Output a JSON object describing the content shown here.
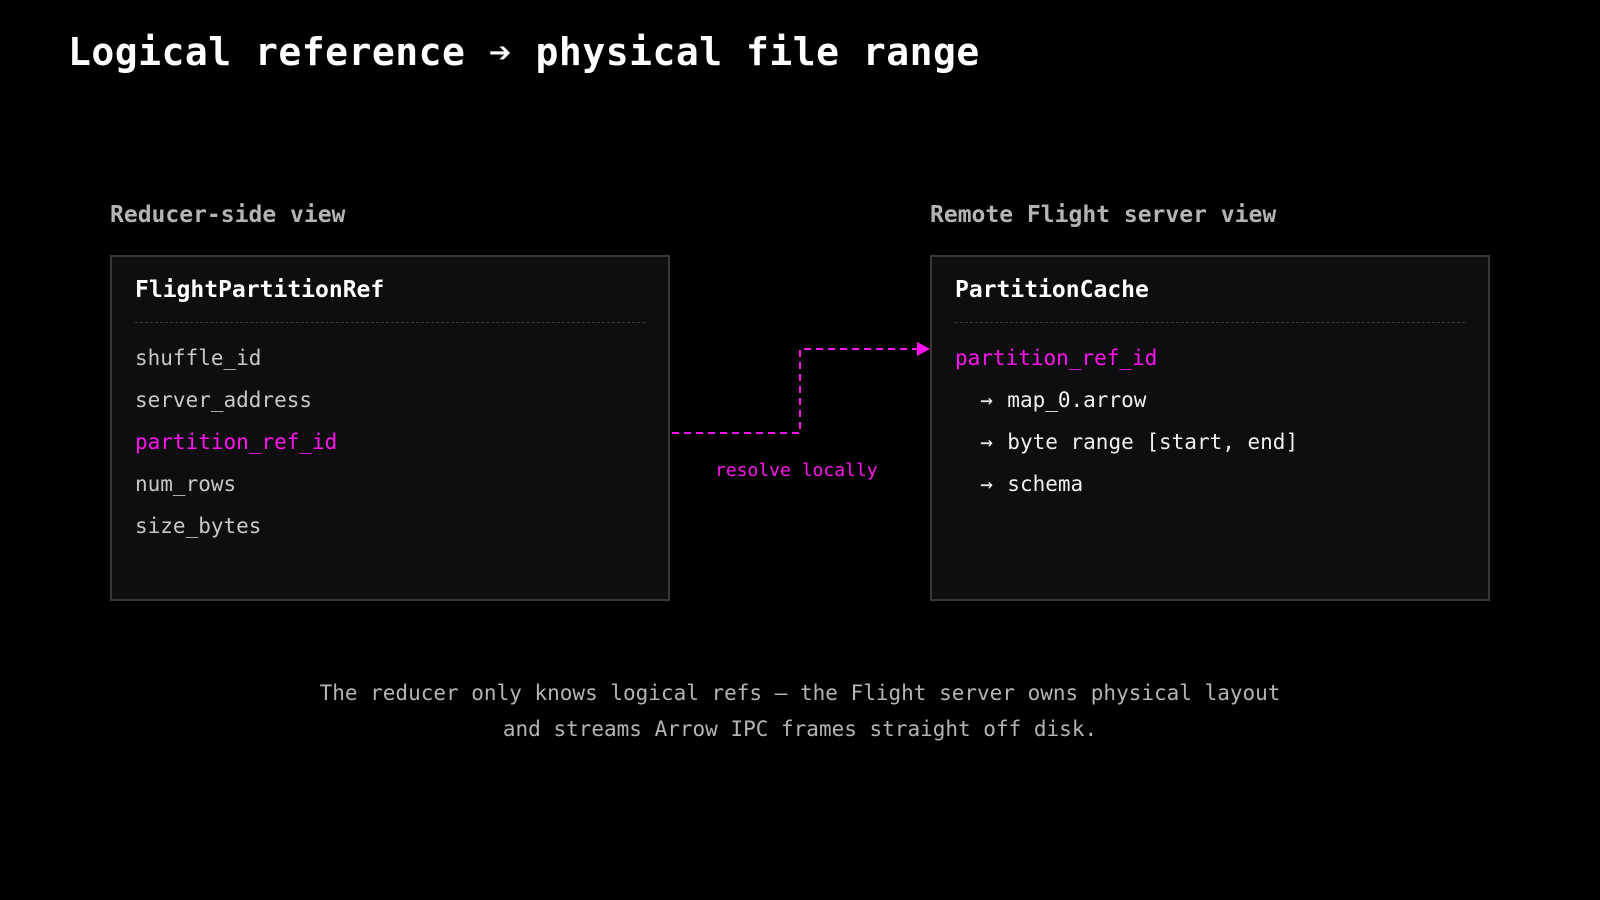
{
  "title": "Logical reference ➔ physical file range",
  "colors": {
    "background": "#000000",
    "panel_background": "#0e0e10",
    "panel_border": "#38383b",
    "accent": "#ff14f0",
    "heading_gray": "#b4b4b4"
  },
  "left_panel": {
    "heading": "Reducer-side view",
    "box_title": "FlightPartitionRef",
    "fields": [
      "shuffle_id",
      "server_address",
      "partition_ref_id",
      "num_rows",
      "size_bytes"
    ],
    "highlighted_field": "partition_ref_id"
  },
  "right_panel": {
    "heading": "Remote Flight server view",
    "box_title": "PartitionCache",
    "key": "partition_ref_id",
    "arrow_symbol": "→",
    "mappings": [
      "map_0.arrow",
      "byte range [start, end]",
      "schema"
    ]
  },
  "connector": {
    "label": "resolve locally",
    "style": "dashed",
    "direction": "left-to-right"
  },
  "caption": {
    "line1": "The reducer only knows logical refs — the Flight server owns physical layout",
    "line2": "and streams Arrow IPC frames straight off disk."
  }
}
